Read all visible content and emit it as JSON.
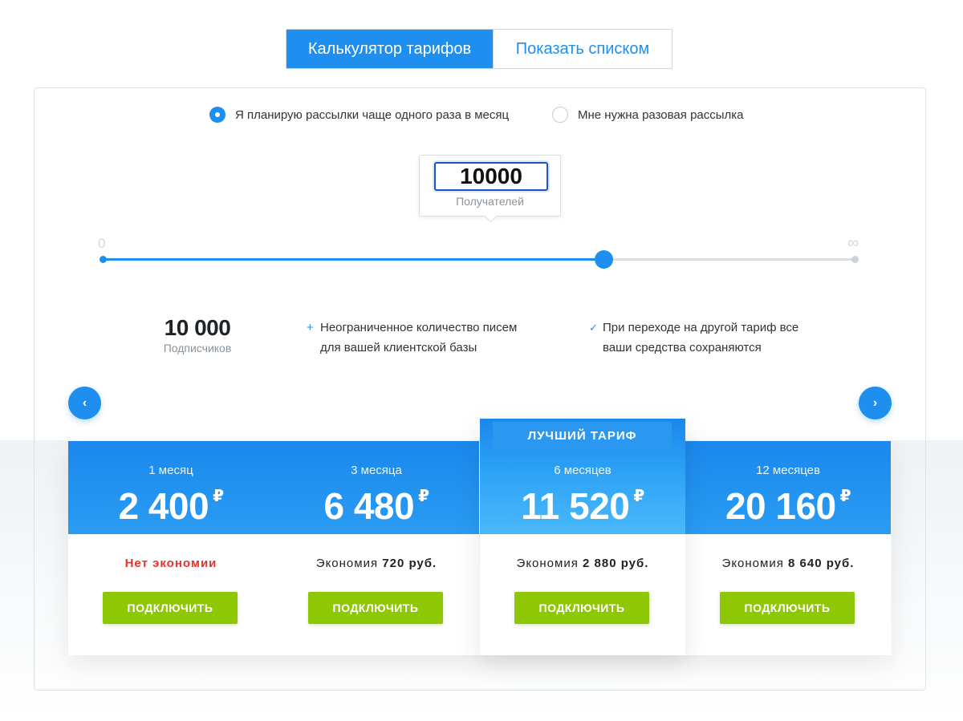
{
  "tabs": {
    "calculator": "Калькулятор тарифов",
    "list": "Показать списком"
  },
  "frequency": {
    "recurring": "Я планирую рассылки чаще одного раза в месяц",
    "one_time": "Мне нужна разовая рассылка",
    "selected": "recurring"
  },
  "recipients": {
    "value": "10000",
    "label": "Получателей"
  },
  "slider": {
    "min_label": "0",
    "max_label": "∞",
    "level": 0.665
  },
  "summary": {
    "subscribers": "10 000",
    "subscribers_label": "Подписчиков",
    "feature_1_icon": "plus-icon",
    "feature_1_line1": "Неограниченное количество писем",
    "feature_1_line2": "для вашей клиентской базы",
    "feature_2_icon": "check-icon",
    "feature_2_line1": "При переходе на другой тариф все",
    "feature_2_line2": "ваши средства сохраняются"
  },
  "navigation": {
    "prev": "‹",
    "next": "›"
  },
  "plans": [
    {
      "period": "1 месяц",
      "price": "2 400",
      "currency": "₽",
      "saving_text": "Нет экономии",
      "saving_prefix": "",
      "saving_amount": "",
      "button": "ПОДКЛЮЧИТЬ"
    },
    {
      "period": "3 месяца",
      "price": "6 480",
      "currency": "₽",
      "saving_text": "",
      "saving_prefix": "Экономия",
      "saving_amount": "720 руб.",
      "button": "ПОДКЛЮЧИТЬ"
    },
    {
      "period": "6 месяцев",
      "price": "11 520",
      "currency": "₽",
      "saving_text": "",
      "saving_prefix": "Экономия",
      "saving_amount": "2 880 руб.",
      "button": "ПОДКЛЮЧИТЬ",
      "badge": "ЛУЧШИЙ ТАРИФ"
    },
    {
      "period": "12 месяцев",
      "price": "20 160",
      "currency": "₽",
      "saving_text": "",
      "saving_prefix": "Экономия",
      "saving_amount": "8 640 руб.",
      "button": "ПОДКЛЮЧИТЬ"
    }
  ],
  "colors": {
    "accent": "#1e8fef",
    "button": "#8ec805",
    "no_saving": "#e6322b"
  }
}
